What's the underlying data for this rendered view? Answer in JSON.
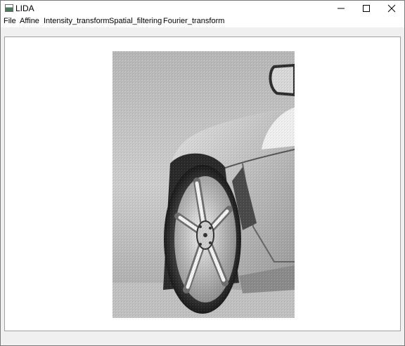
{
  "window": {
    "title": "LIDA",
    "controls": {
      "minimize_icon": "minimize-icon",
      "maximize_icon": "maximize-icon",
      "close_icon": "close-icon"
    }
  },
  "menubar": {
    "items": [
      {
        "label": "File"
      },
      {
        "label": "Affine"
      },
      {
        "label": "Intensity_transform"
      },
      {
        "label": "Spatial_filtering"
      },
      {
        "label": "Fourier_transform"
      }
    ]
  },
  "canvas": {
    "image_description": "grayscale photo of a sports car rear wheel"
  },
  "colors": {
    "titlebar": "#ffffff",
    "menubar": "#ffffff",
    "window_bg": "#f0f0f0",
    "canvas_bg": "#ffffff"
  }
}
